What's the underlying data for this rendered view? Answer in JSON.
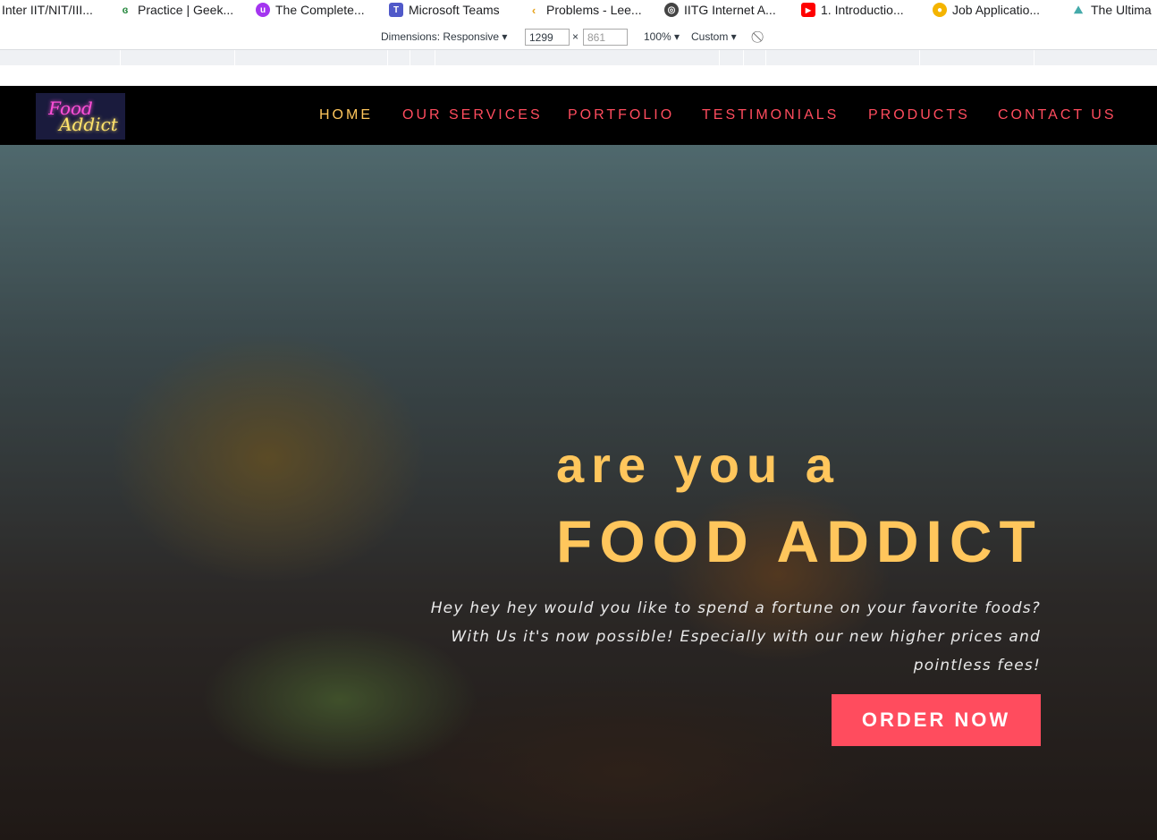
{
  "browser": {
    "bookmarks": [
      {
        "label": "Inter IIT/NIT/III...",
        "icon": "none"
      },
      {
        "label": "Practice | Geek...",
        "icon": "geeksforgeeks-icon"
      },
      {
        "label": "The Complete...",
        "icon": "udemy-icon"
      },
      {
        "label": "Microsoft Teams",
        "icon": "teams-icon"
      },
      {
        "label": "Problems - Lee...",
        "icon": "leetcode-icon"
      },
      {
        "label": "IITG Internet A...",
        "icon": "globe-icon"
      },
      {
        "label": "1. Introductio...",
        "icon": "youtube-icon"
      },
      {
        "label": "Job Applicatio...",
        "icon": "app-icon"
      },
      {
        "label": "The Ultima",
        "icon": "bookmark-icon"
      }
    ]
  },
  "devtools": {
    "dimensions_label": "Dimensions: Responsive ▾",
    "width_value": "1299",
    "times_label": "×",
    "height_value": "861",
    "zoom_label": "100% ▾",
    "throttle_label": "Custom ▾"
  },
  "site": {
    "logo": {
      "line1": "Food",
      "line2": "Addict"
    },
    "nav": [
      {
        "label": "HOME",
        "active": true
      },
      {
        "label": "OUR SERVICES",
        "active": false
      },
      {
        "label": "PORTFOLIO",
        "active": false
      },
      {
        "label": "TESTIMONIALS",
        "active": false
      },
      {
        "label": "PRODUCTS",
        "active": false
      },
      {
        "label": "CONTACT US",
        "active": false
      }
    ],
    "hero": {
      "eyebrow": "are you a",
      "title": "FOOD ADDICT",
      "text": "Hey hey hey would you like to spend a fortune on your favorite foods? With Us it's now possible! Especially with our new higher prices and pointless fees!",
      "cta": "ORDER NOW"
    },
    "colors": {
      "accent": "#ff4c5e",
      "highlight": "#ffc65c",
      "nav_bg": "#000000"
    }
  }
}
